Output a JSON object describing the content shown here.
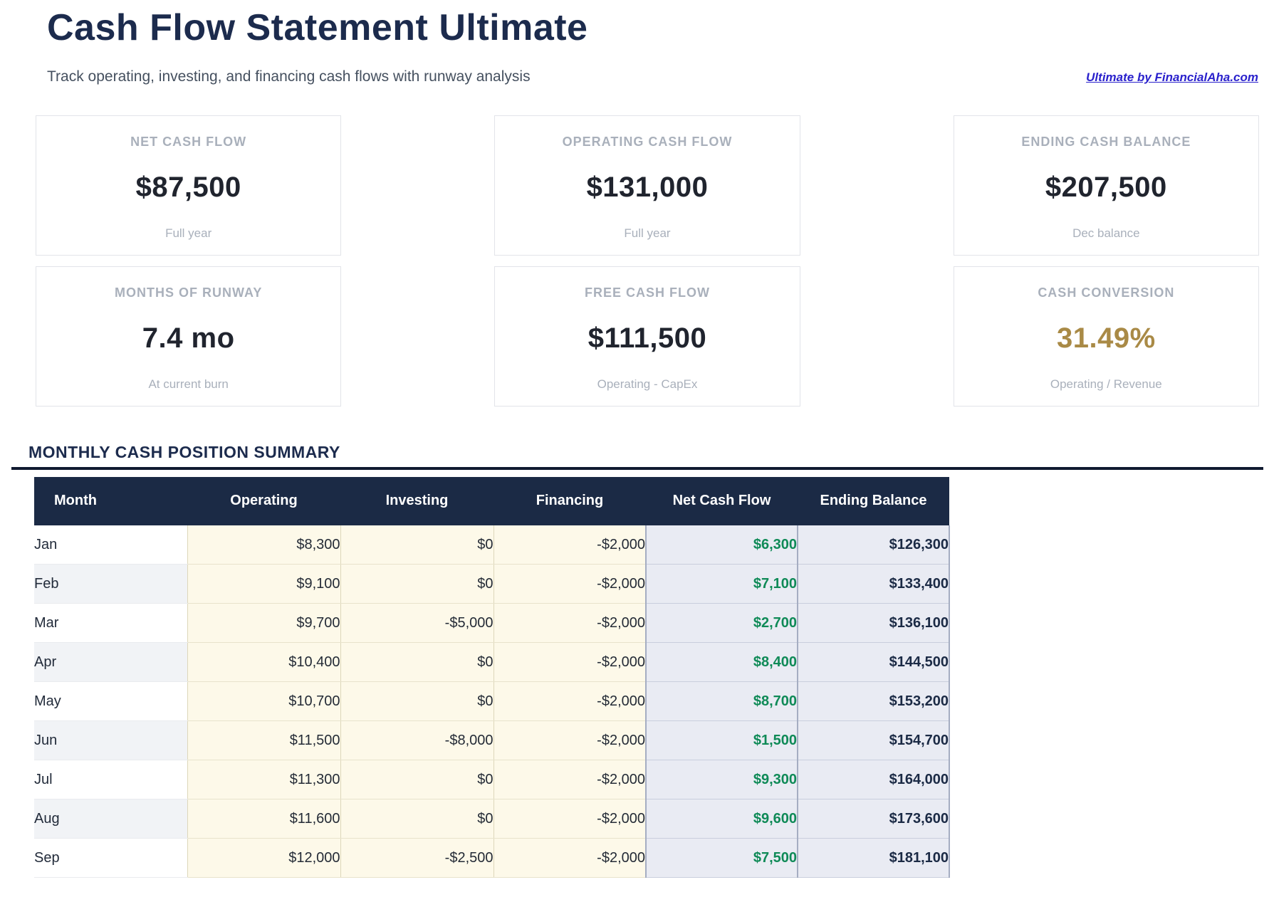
{
  "header": {
    "title": "Cash Flow Statement Ultimate",
    "subtitle": "Track operating, investing, and financing cash flows with runway analysis",
    "link_label": "Ultimate by FinancialAha.com"
  },
  "kpis": [
    {
      "label": "NET CASH FLOW",
      "value": "$87,500",
      "caption": "Full year",
      "accent": "default"
    },
    {
      "label": "OPERATING CASH FLOW",
      "value": "$131,000",
      "caption": "Full year",
      "accent": "default"
    },
    {
      "label": "ENDING CASH BALANCE",
      "value": "$207,500",
      "caption": "Dec balance",
      "accent": "default"
    },
    {
      "label": "MONTHS OF RUNWAY",
      "value": "7.4 mo",
      "caption": "At current burn",
      "accent": "default"
    },
    {
      "label": "FREE CASH FLOW",
      "value": "$111,500",
      "caption": "Operating - CapEx",
      "accent": "default"
    },
    {
      "label": "CASH CONVERSION",
      "value": "31.49%",
      "caption": "Operating / Revenue",
      "accent": "gold"
    }
  ],
  "table": {
    "section_title": "MONTHLY CASH POSITION SUMMARY",
    "columns": [
      "Month",
      "Operating",
      "Investing",
      "Financing",
      "Net Cash Flow",
      "Ending Balance"
    ],
    "rows": [
      {
        "month": "Jan",
        "operating": "$8,300",
        "investing": "$0",
        "financing": "-$2,000",
        "net": "$6,300",
        "ending": "$126,300"
      },
      {
        "month": "Feb",
        "operating": "$9,100",
        "investing": "$0",
        "financing": "-$2,000",
        "net": "$7,100",
        "ending": "$133,400"
      },
      {
        "month": "Mar",
        "operating": "$9,700",
        "investing": "-$5,000",
        "financing": "-$2,000",
        "net": "$2,700",
        "ending": "$136,100"
      },
      {
        "month": "Apr",
        "operating": "$10,400",
        "investing": "$0",
        "financing": "-$2,000",
        "net": "$8,400",
        "ending": "$144,500"
      },
      {
        "month": "May",
        "operating": "$10,700",
        "investing": "$0",
        "financing": "-$2,000",
        "net": "$8,700",
        "ending": "$153,200"
      },
      {
        "month": "Jun",
        "operating": "$11,500",
        "investing": "-$8,000",
        "financing": "-$2,000",
        "net": "$1,500",
        "ending": "$154,700"
      },
      {
        "month": "Jul",
        "operating": "$11,300",
        "investing": "$0",
        "financing": "-$2,000",
        "net": "$9,300",
        "ending": "$164,000"
      },
      {
        "month": "Aug",
        "operating": "$11,600",
        "investing": "$0",
        "financing": "-$2,000",
        "net": "$9,600",
        "ending": "$173,600"
      },
      {
        "month": "Sep",
        "operating": "$12,000",
        "investing": "-$2,500",
        "financing": "-$2,000",
        "net": "$7,500",
        "ending": "$181,100"
      }
    ]
  },
  "colors": {
    "navy": "#1c2b4d",
    "table_header_bg": "#1b2a45",
    "divider": "#101a30",
    "gold": "#a98a46",
    "positive_green": "#0f8a57",
    "link_blue": "#2a21cc",
    "flow_cell_cream": "#fdf9e9",
    "summary_cell_lavender": "#e9ebf3"
  }
}
